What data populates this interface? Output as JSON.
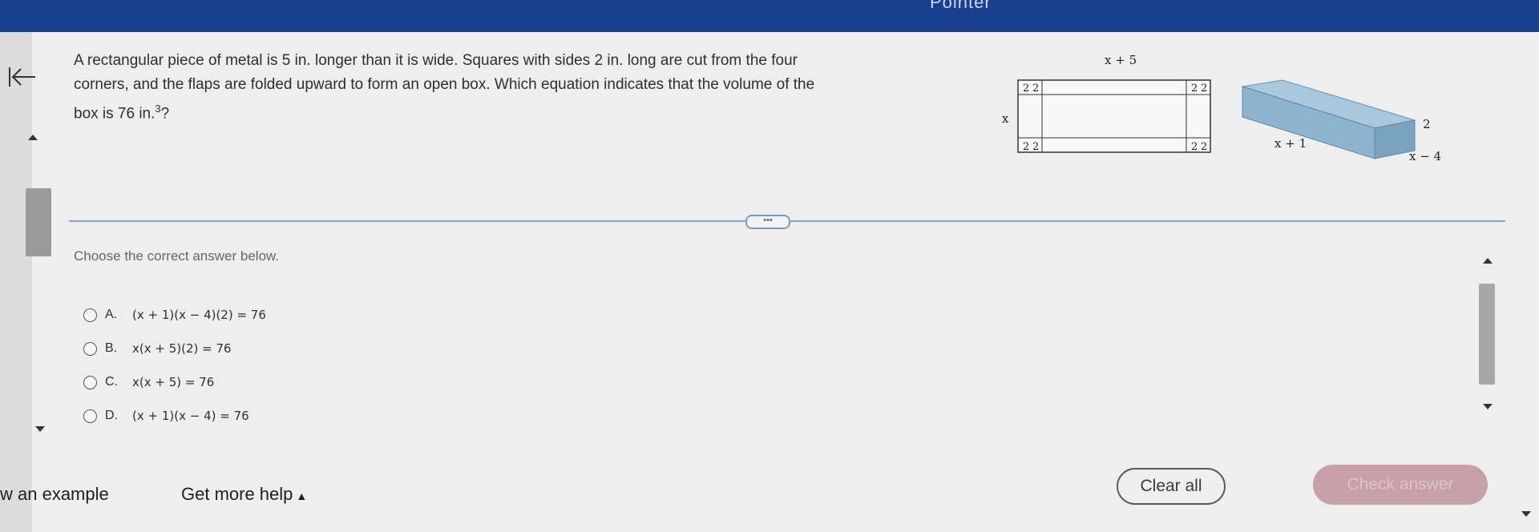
{
  "header": {
    "title_fragment": "Pointer"
  },
  "question": {
    "text_lines": [
      "A rectangular piece of metal is 5 in. longer than it is wide. Squares with sides 2 in. long are cut from the four",
      "corners, and the flaps are folded upward to form an open box. Which equation indicates that the volume of the"
    ],
    "last_line_prefix": "box is 76 in.",
    "last_line_sup": "3",
    "last_line_suffix": "?"
  },
  "diagram": {
    "top_label": "x + 5",
    "side_label": "x",
    "corner_labels": [
      "2",
      "2"
    ],
    "box_length_label": "x + 1",
    "box_height_label": "2",
    "box_width_label": "x − 4"
  },
  "divider_button_label": "•••",
  "prompt": "Choose the correct answer below.",
  "options": [
    {
      "letter": "A.",
      "text": "(x + 1)(x − 4)(2) = 76"
    },
    {
      "letter": "B.",
      "text": "x(x + 5)(2) = 76"
    },
    {
      "letter": "C.",
      "text": "x(x + 5) = 76"
    },
    {
      "letter": "D.",
      "text": "(x + 1)(x − 4) = 76"
    }
  ],
  "footer": {
    "example_link": "w an example",
    "help_link": "Get more help",
    "help_caret": "▲",
    "clear_button": "Clear all",
    "check_button": "Check answer"
  },
  "colors": {
    "topbar": "#1b3f8f",
    "check_button": "#c8a0aa",
    "divider": "#8aa2c8"
  }
}
